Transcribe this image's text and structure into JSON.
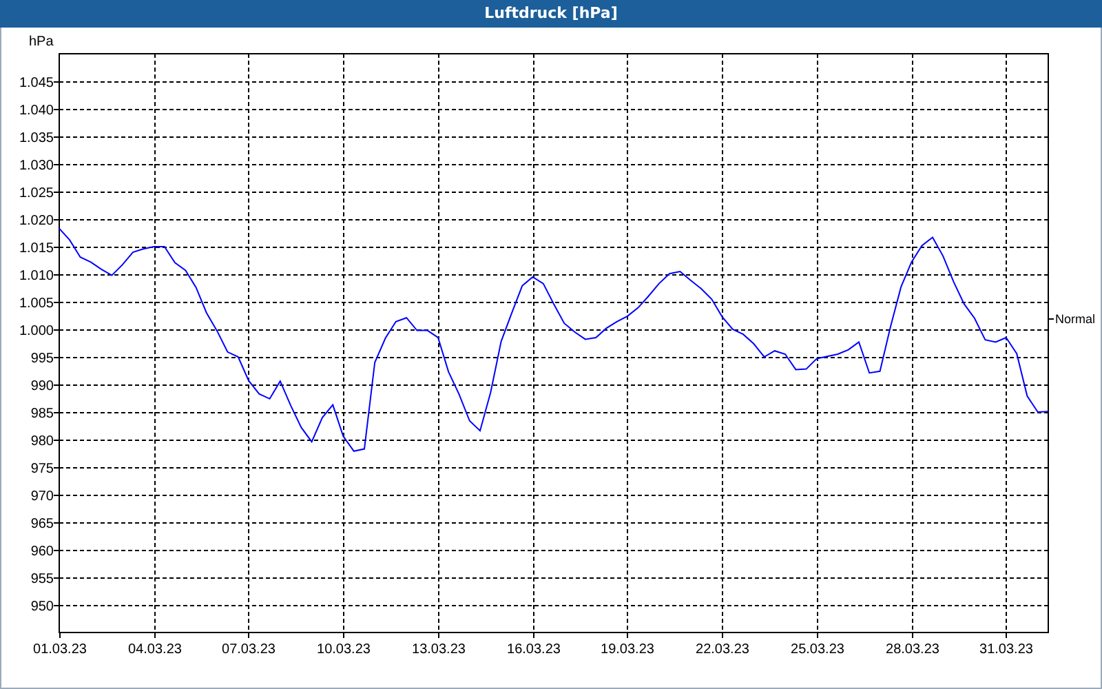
{
  "chart_data": {
    "type": "line",
    "title": "Luftdruck [hPa]",
    "ylabel": "hPa",
    "grid": true,
    "categories": [
      "01.03.23",
      null,
      null,
      null,
      null,
      null,
      null,
      null,
      null,
      "04.03.23",
      null,
      null,
      null,
      null,
      null,
      null,
      null,
      null,
      "07.03.23",
      null,
      null,
      null,
      null,
      null,
      null,
      null,
      null,
      "10.03.23",
      null,
      null,
      null,
      null,
      null,
      null,
      null,
      null,
      "13.03.23",
      null,
      null,
      null,
      null,
      null,
      null,
      null,
      null,
      "16.03.23",
      null,
      null,
      null,
      null,
      null,
      null,
      null,
      null,
      "19.03.23",
      null,
      null,
      null,
      null,
      null,
      null,
      null,
      null,
      "22.03.23",
      null,
      null,
      null,
      null,
      null,
      null,
      null,
      null,
      "25.03.23",
      null,
      null,
      null,
      null,
      null,
      null,
      null,
      null,
      "28.03.23",
      null,
      null,
      null,
      null,
      null,
      null,
      null,
      null,
      "31.03.23",
      null,
      null,
      null,
      null
    ],
    "series": [
      {
        "color": "#0000ff",
        "values": [
          1018.3,
          1016.2,
          1013.1,
          1012.2,
          1010.9,
          1009.8,
          1011.7,
          1014.0,
          1014.6,
          1015.0,
          1015.0,
          1012.1,
          1010.7,
          1007.6,
          1003.0,
          999.7,
          995.9,
          995.0,
          990.7,
          988.3,
          987.4,
          990.6,
          986.2,
          982.2,
          979.6,
          984.0,
          986.3,
          980.6,
          977.9,
          978.3,
          994.0,
          998.4,
          1001.4,
          1002.1,
          999.8,
          999.8,
          998.5,
          992.3,
          988.2,
          983.4,
          981.6,
          988.6,
          997.8,
          1002.9,
          1007.9,
          1009.5,
          1008.3,
          1004.6,
          1001.1,
          999.5,
          998.2,
          998.5,
          1000.2,
          1001.4,
          1002.4,
          1003.9,
          1006.0,
          1008.3,
          1010.1,
          1010.5,
          1008.9,
          1007.4,
          1005.5,
          1002.3,
          1000.0,
          999.1,
          997.4,
          995.0,
          996.1,
          995.5,
          992.7,
          992.8,
          994.7,
          995.1,
          995.5,
          996.3,
          997.7,
          992.1,
          992.4,
          1000.4,
          1007.7,
          1012.2,
          1015.2,
          1016.7,
          1013.3,
          1008.6,
          1004.6,
          1002.0,
          998.1,
          997.7,
          998.5,
          995.6,
          987.9,
          985.0,
          985.1
        ]
      }
    ],
    "ylim": [
      945,
      1050
    ],
    "yticks": [
      {
        "value": 1045,
        "label": "1.045"
      },
      {
        "value": 1040,
        "label": "1.040"
      },
      {
        "value": 1035,
        "label": "1.035"
      },
      {
        "value": 1030,
        "label": "1.030"
      },
      {
        "value": 1025,
        "label": "1.025"
      },
      {
        "value": 1020,
        "label": "1.020"
      },
      {
        "value": 1015,
        "label": "1.015"
      },
      {
        "value": 1010,
        "label": "1.010"
      },
      {
        "value": 1005,
        "label": "1.005"
      },
      {
        "value": 1000,
        "label": "1.000"
      },
      {
        "value": 995,
        "label": "995"
      },
      {
        "value": 990,
        "label": "990"
      },
      {
        "value": 985,
        "label": "985"
      },
      {
        "value": 980,
        "label": "980"
      },
      {
        "value": 975,
        "label": "975"
      },
      {
        "value": 970,
        "label": "970"
      },
      {
        "value": 965,
        "label": "965"
      },
      {
        "value": 960,
        "label": "960"
      },
      {
        "value": 955,
        "label": "955"
      },
      {
        "value": 950,
        "label": "950"
      }
    ],
    "annotations": [
      "Normal"
    ]
  }
}
